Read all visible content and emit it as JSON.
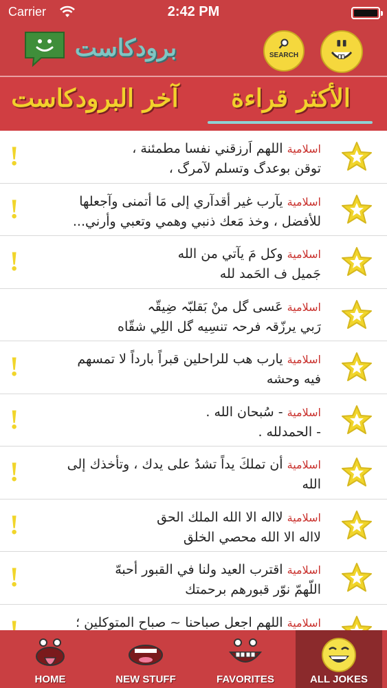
{
  "status_bar": {
    "carrier": "Carrier",
    "time": "2:42 PM"
  },
  "header": {
    "title": "برودكاست",
    "search_label": "SEARCH",
    "icons": [
      "chat-smiley-icon",
      "search-icon",
      "smiley-face-icon"
    ]
  },
  "tabs": [
    {
      "label": "آخر البرودكاست",
      "selected": false
    },
    {
      "label": "الأكثر قراءة",
      "selected": true
    }
  ],
  "colors": {
    "primary": "#c93f42",
    "accent_yellow": "#f2d12c",
    "category_red": "#c9302c",
    "underline": "#8fd2d4"
  },
  "list": {
    "items": [
      {
        "category": "اسلامية",
        "line1": "اللهم اَرزقني نفسا مطمئنة ،",
        "line2": "توقن بوعدگ وتسلم لآمرگ ،"
      },
      {
        "category": "اسلامية",
        "line1": "يآرب غير أقدآري إلى مَا أتمنى وآجعلها",
        "line2": "للأفضل ، وخذ مَعك ذنبي وهمي وتعبي وأرني..."
      },
      {
        "category": "اسلامية",
        "line1": "وكل مَ يآتي من الله",
        "line2": "جَميل ف الحَمد لله"
      },
      {
        "category": "اسلامية",
        "line1": "عَسى گل منْ بَقلبّہ ضِيقّہ",
        "line2": "رَبي يرزّقہ فرحہ تنسِيه گل اللِي شقّاه"
      },
      {
        "category": "اسلامية",
        "line1": "يارب هب للراحلين قبراً بارداً لا تمسهم",
        "line2": "فيه وحشه"
      },
      {
        "category": "اسلامية",
        "line1": "- سُبحان الله .",
        "line2": "- الحمدلله ."
      },
      {
        "category": "اسلامية",
        "line1": "أن تملكَ يداً تشدُ على يدك ، وتأخذك إلى",
        "line2": "الله"
      },
      {
        "category": "اسلامية",
        "line1": "لااله الا الله الملك الحق",
        "line2": "لااله الا الله محصي الخلق"
      },
      {
        "category": "اسلامية",
        "line1": "اقترب العيد ولنا في القبور أحبهّ",
        "line2": "اللّهمّ نوّر قبورهم برحمتك"
      },
      {
        "category": "اسلامية",
        "line1": "اللهم اجعل صباحنا ~ صباح المتوكلين ؛",
        "line2": ""
      }
    ]
  },
  "tab_bar": {
    "items": [
      {
        "label": "HOME",
        "icon": "tongue-face-icon",
        "selected": false
      },
      {
        "label": "NEW STUFF",
        "icon": "mouth-icon",
        "selected": false
      },
      {
        "label": "FAVORITES",
        "icon": "toothy-face-icon",
        "selected": false
      },
      {
        "label": "ALL JOKES",
        "icon": "laughing-smiley-icon",
        "selected": true
      }
    ]
  }
}
